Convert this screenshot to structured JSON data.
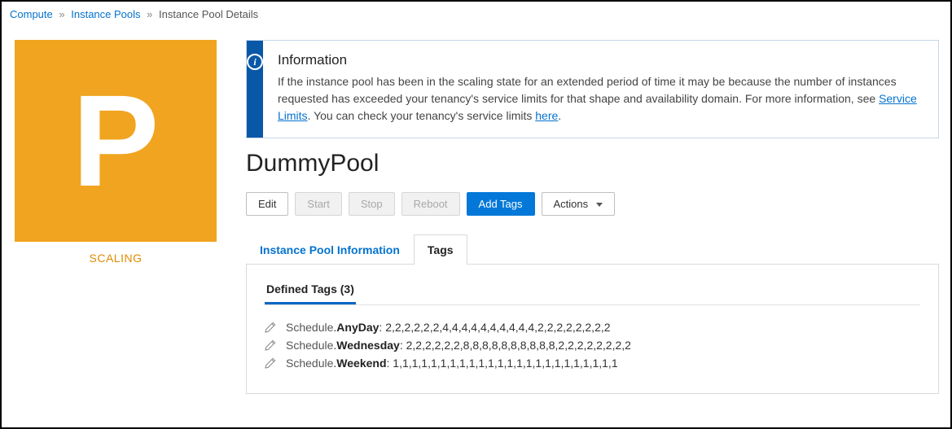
{
  "breadcrumb": {
    "items": [
      "Compute",
      "Instance Pools"
    ],
    "current": "Instance Pool Details"
  },
  "tile": {
    "letter": "P",
    "status": "SCALING"
  },
  "info": {
    "heading": "Information",
    "body_pre": "If the instance pool has been in the scaling state for an extended period of time it may be because the number of instances requested has exceeded your tenancy's service limits for that shape and availability domain. For more information, see ",
    "link1": "Service Limits",
    "body_mid": ". You can check your tenancy's service limits ",
    "link2": "here",
    "body_post": "."
  },
  "title": "DummyPool",
  "buttons": {
    "edit": "Edit",
    "start": "Start",
    "stop": "Stop",
    "reboot": "Reboot",
    "add_tags": "Add Tags",
    "actions": "Actions"
  },
  "tabs": {
    "info": "Instance Pool Information",
    "tags": "Tags"
  },
  "defined_tags_heading": "Defined Tags (3)",
  "tags_list": [
    {
      "ns": "Schedule",
      "key": "AnyDay",
      "val": "2,2,2,2,2,2,4,4,4,4,4,4,4,4,4,4,2,2,2,2,2,2,2,2"
    },
    {
      "ns": "Schedule",
      "key": "Wednesday",
      "val": "2,2,2,2,2,2,8,8,8,8,8,8,8,8,8,8,2,2,2,2,2,2,2,2"
    },
    {
      "ns": "Schedule",
      "key": "Weekend",
      "val": "1,1,1,1,1,1,1,1,1,1,1,1,1,1,1,1,1,1,1,1,1,1,1,1"
    }
  ]
}
